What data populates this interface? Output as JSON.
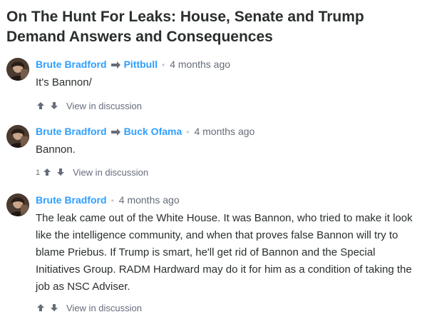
{
  "thread": {
    "title": "On The Hunt For Leaks: House, Senate and Trump Demand Answers and Consequences"
  },
  "comments": [
    {
      "author": "Brute Bradford",
      "reply_to": "Pittbull",
      "separator": "•",
      "time": "4 months ago",
      "message": "It's Bannon/",
      "vote_count": "",
      "view_link": "View in discussion"
    },
    {
      "author": "Brute Bradford",
      "reply_to": "Buck Ofama",
      "separator": "•",
      "time": "4 months ago",
      "message": "Bannon.",
      "vote_count": "1",
      "view_link": "View in discussion"
    },
    {
      "author": "Brute Bradford",
      "reply_to": "",
      "separator": "•",
      "time": "4 months ago",
      "message": "The leak came out of the White House. It was Bannon, who tried to make it look like the intelligence community, and when that proves false Bannon will try to blame Priebus. If Trump is smart, he'll get rid of Bannon and the Special Initiatives Group. RADM Hardward may do it for him as a condition of taking the job as NSC Adviser.",
      "vote_count": "",
      "view_link": "View in discussion"
    }
  ],
  "colors": {
    "author_link": "#2e9fff",
    "muted_text": "#656c7a",
    "title_text": "#2a2e2e"
  },
  "icons": [
    "avatar",
    "reply-arrow-icon",
    "upvote-arrow-icon",
    "downvote-arrow-icon"
  ]
}
